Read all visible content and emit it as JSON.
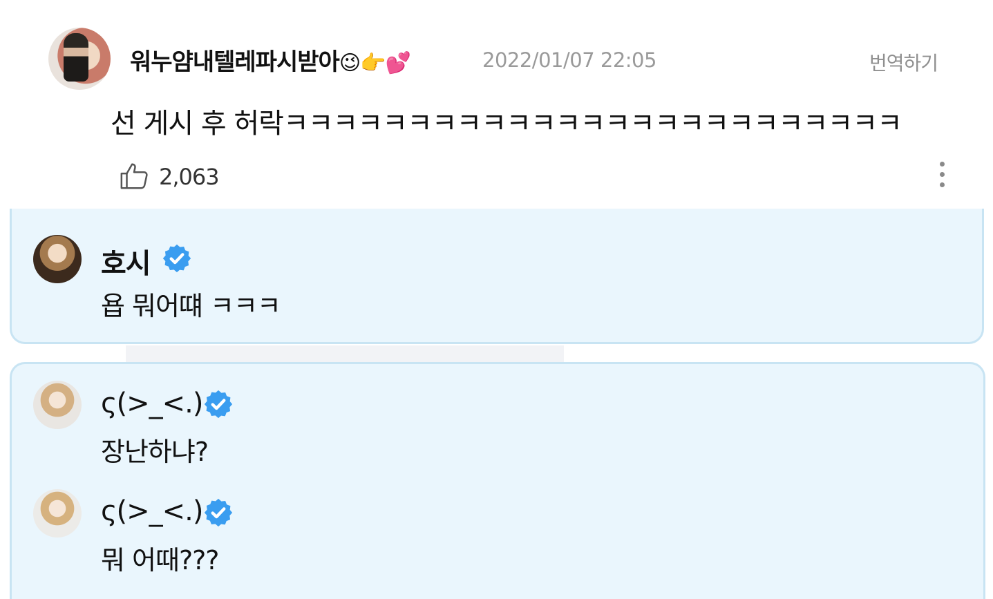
{
  "post": {
    "username": "워누얌내텔레파시받아",
    "username_emojis": "😉👉💕",
    "timestamp": "2022/01/07 22:05",
    "translate_label": "번역하기",
    "text": "선 게시 후 허락ㅋㅋㅋㅋㅋㅋㅋㅋㅋㅋㅋㅋㅋㅋㅋㅋㅋㅋㅋㅋㅋㅋㅋㅋㅋ",
    "like_count": "2,063",
    "like_icon": "thumbs-up-icon",
    "more_icon": "more-vertical-icon"
  },
  "replies": [
    {
      "name": "호시",
      "verified": true,
      "message": "욥 뭐어떄 ㅋㅋㅋ"
    },
    {
      "name": "ς(>_<.)",
      "verified": true,
      "message": "장난하냐?"
    },
    {
      "name": "ς(>_<.)",
      "verified": true,
      "message": "뭐 어때???"
    }
  ],
  "colors": {
    "card_bg": "#eaf6fd",
    "card_border": "#c8e4f3",
    "verified_badge": "#3a9df0",
    "timestamp": "#9a9a9a"
  }
}
